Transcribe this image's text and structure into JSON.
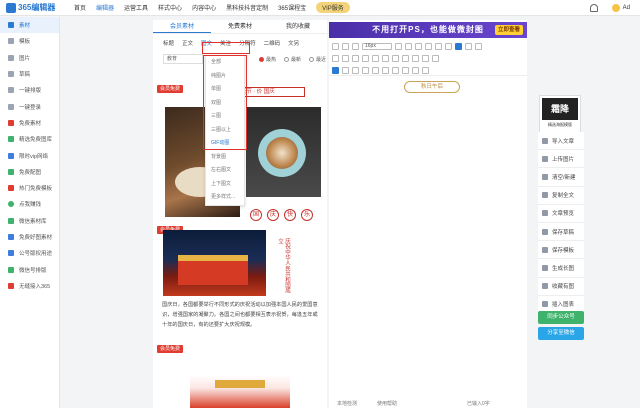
{
  "app": {
    "logo_text": "365编辑器"
  },
  "topnav": {
    "items": [
      "首页",
      "编辑器",
      "运营工具",
      "样式中心",
      "内容中心",
      "黑科技抖音定制",
      "365课程宝"
    ],
    "vip": "VIP服务",
    "user": "Ad"
  },
  "sidebar": {
    "items": [
      "素材",
      "模板",
      "图片",
      "草稿",
      "一键排版",
      "一键登录",
      "免费素材",
      "精选免费图库",
      "限时vip网络",
      "免费配图",
      "热门免费模板",
      "点我赚钱",
      "微信素材库",
      "免费好图素材",
      "公号版权用途",
      "微信号排版",
      "无缝接入365"
    ]
  },
  "panel": {
    "tabs": [
      "会员素材",
      "免费素材",
      "我的收藏"
    ],
    "cats": [
      "标题",
      "正文",
      "图文",
      "关注",
      "分隔符",
      "二维码",
      "文另"
    ],
    "filter_select": "教育",
    "radios": [
      "最热",
      "最新",
      "最近"
    ],
    "dropdown": [
      "全部",
      "纯图片",
      "单图",
      "双图",
      "三图",
      "三图以上",
      "GIF动图",
      "背景图",
      "左右图文",
      "上下图文",
      "更多样式..."
    ],
    "tag": "会员免费",
    "banner_title": "國庆节 · 价 国庆",
    "circles": [
      "国",
      "庆",
      "快",
      "乐"
    ],
    "vertical_text": "庆祝中华人民共和国成立",
    "paragraph": "国庆日，各国都要举行不同形式的庆祝活动以加强本国人民的爱国意识，增强国家的凝聚力。各国之间也都要相互表示祝贺，每逢五年或十年的国庆日，有的还要扩大庆祝规模。",
    "vertical_text2": "庆祝中华人民共和国成立"
  },
  "editor": {
    "ad_text": "不用打开PS，也能做微封图",
    "ad_button": "立即查看",
    "font_size": "16px",
    "doc_tag": "秋日午后",
    "footer": [
      "本地检测",
      "使用帮助",
      "已输入0字"
    ]
  },
  "rightbar": {
    "qr_title": "霜降",
    "qr_sub": "精选海报模版",
    "items": [
      "导入文章",
      "上传图片",
      "清空/新建",
      "复制全文",
      "文章预览",
      "保存草稿",
      "保存模板",
      "生成长图",
      "收藏有图",
      "插入图表"
    ],
    "btn1": "同步公众号",
    "btn2": "分享至微信"
  }
}
